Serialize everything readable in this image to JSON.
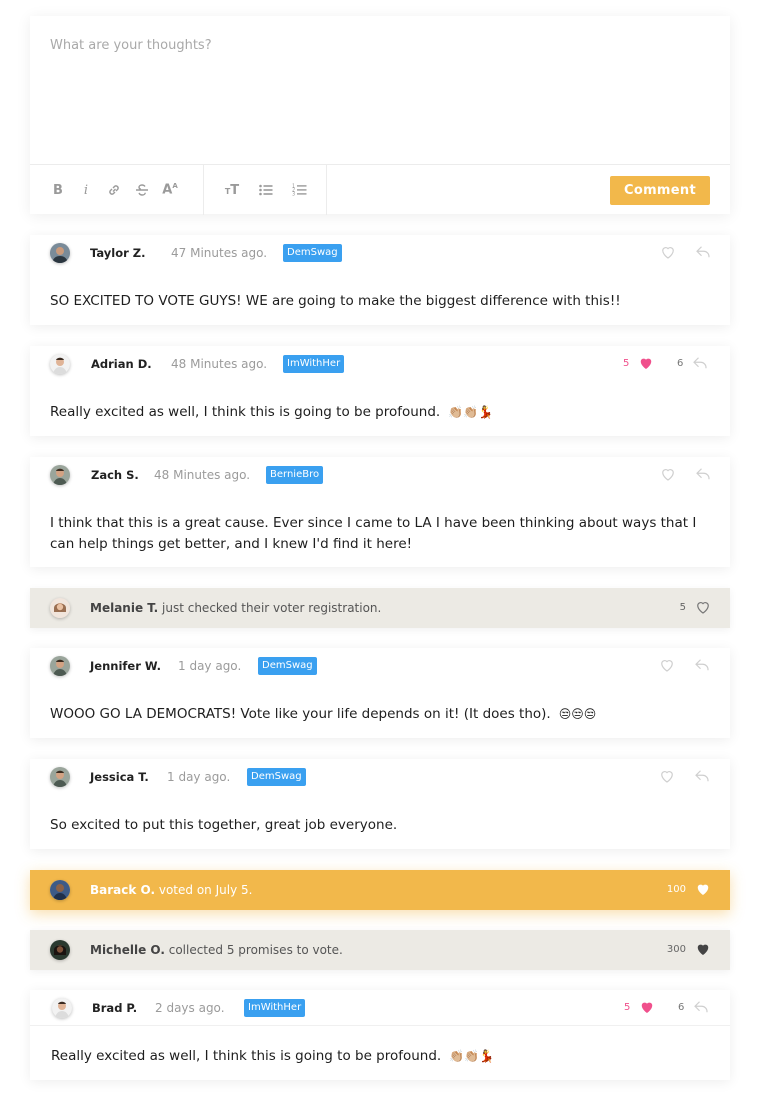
{
  "editor": {
    "placeholder": "What are your thoughts?",
    "toolbar": {
      "bold": "B",
      "italic": "i",
      "font_size": "A",
      "text_size": "T",
      "comment_label": "Comment"
    }
  },
  "comments": [
    {
      "name": "Taylor Z.",
      "time": "47 Minutes ago.",
      "tag": "DemSwag",
      "text": "SO EXCITED TO VOTE GUYS! WE are going to make the biggest difference with this!!",
      "liked": false
    },
    {
      "name": "Adrian D.",
      "time": "48 Minutes ago.",
      "tag": "ImWithHer",
      "text": "Really excited as well, I think this is going to be profound.",
      "emoji": "👏🏼👏🏼💃",
      "likes": "5",
      "replies": "6",
      "liked": true
    },
    {
      "name": "Zach S.",
      "time": "48 Minutes ago.",
      "tag": "BernieBro",
      "text": "I think that this is a great cause. Ever since I came to LA I have been thinking about ways that I can help things get better, and I knew I'd find it here!",
      "liked": false
    },
    {
      "name": "Jennifer W.",
      "time": "1 day ago.",
      "tag": "DemSwag",
      "text": "WOOO GO LA DEMOCRATS! Vote like your life depends on it! (It does tho).",
      "emoji": "😒😒😒",
      "liked": false
    },
    {
      "name": "Jessica T.",
      "time": "1 day ago.",
      "tag": "DemSwag",
      "text": "So excited to put this together, great job everyone.",
      "liked": false
    },
    {
      "name": "Brad P.",
      "time": "2 days ago.",
      "tag": "ImWithHer",
      "text": "Really excited as well, I think this is going to be profound.",
      "emoji": "👏🏼👏🏼💃",
      "likes": "5",
      "replies": "6",
      "liked": true
    }
  ],
  "activities": [
    {
      "name": "Melanie T.",
      "text": "just checked their voter registration.",
      "count": "5"
    },
    {
      "name": "Barack O.",
      "text": "voted on July 5.",
      "count": "100"
    },
    {
      "name": "Michelle O.",
      "text": "collected 5 promises to vote.",
      "count": "300"
    }
  ],
  "colors": {
    "accent": "#f2b84b",
    "tag": "#3aa0f0",
    "heart": "#f0508c",
    "activity_bg": "#eceae4"
  }
}
